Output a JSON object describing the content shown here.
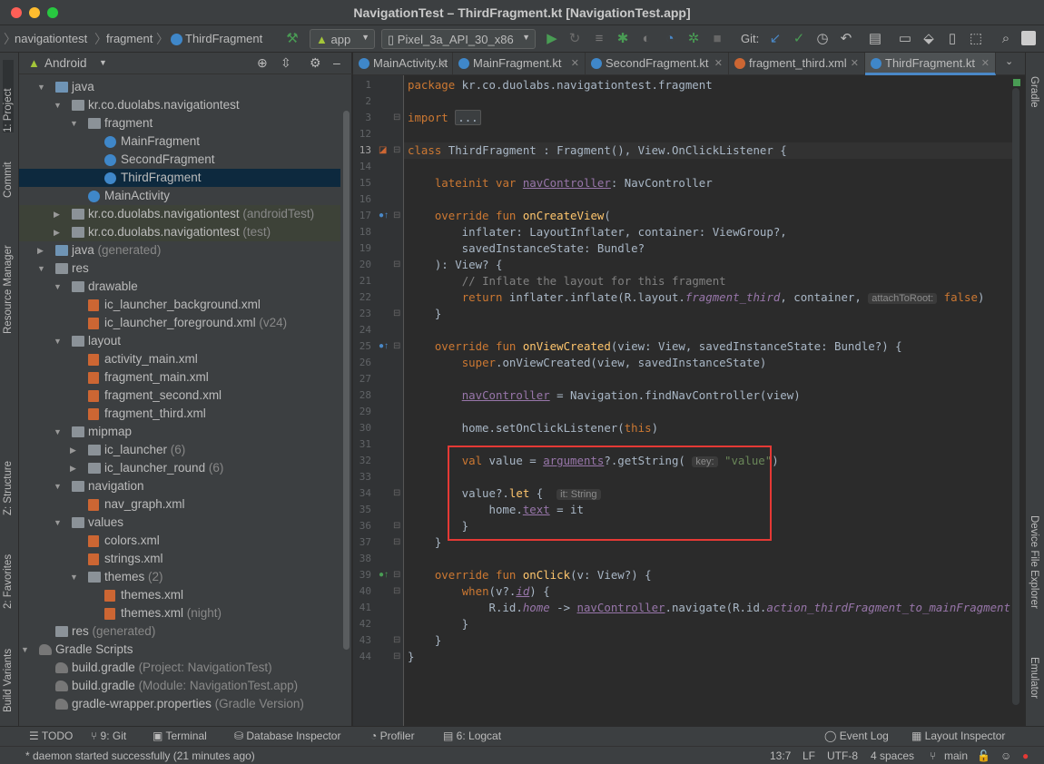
{
  "window": {
    "title": "NavigationTest – ThirdFragment.kt [NavigationTest.app]"
  },
  "breadcrumbs": [
    "navigationtest",
    "fragment",
    "ThirdFragment"
  ],
  "toolbar": {
    "run_config": "app",
    "device": "Pixel_3a_API_30_x86",
    "git_label": "Git:"
  },
  "left_tools": [
    "1: Project",
    "Commit",
    "Resource Manager",
    "Z: Structure",
    "2: Favorites",
    "Build Variants"
  ],
  "right_tools": [
    "Gradle",
    "Device File Explorer",
    "Emulator"
  ],
  "project_panel": {
    "view_mode": "Android"
  },
  "tree": [
    {
      "label": "java",
      "suffix": "",
      "depth": 0,
      "icon": "folder blue",
      "arrow": "down"
    },
    {
      "label": "kr.co.duolabs.navigationtest",
      "suffix": "",
      "depth": 1,
      "icon": "folder",
      "arrow": "down"
    },
    {
      "label": "fragment",
      "suffix": "",
      "depth": 2,
      "icon": "folder",
      "arrow": "down"
    },
    {
      "label": "MainFragment",
      "suffix": "",
      "depth": 3,
      "icon": "kt",
      "arrow": ""
    },
    {
      "label": "SecondFragment",
      "suffix": "",
      "depth": 3,
      "icon": "kt",
      "arrow": ""
    },
    {
      "label": "ThirdFragment",
      "suffix": "",
      "depth": 3,
      "icon": "kt",
      "arrow": "",
      "selected": true
    },
    {
      "label": "MainActivity",
      "suffix": "",
      "depth": 2,
      "icon": "kt",
      "arrow": ""
    },
    {
      "label": "kr.co.duolabs.navigationtest",
      "suffix": "(androidTest)",
      "depth": 1,
      "icon": "folder",
      "arrow": "right",
      "test": true
    },
    {
      "label": "kr.co.duolabs.navigationtest",
      "suffix": "(test)",
      "depth": 1,
      "icon": "folder",
      "arrow": "right",
      "test": true
    },
    {
      "label": "java",
      "suffix": "(generated)",
      "depth": 0,
      "icon": "folder blue",
      "arrow": "right"
    },
    {
      "label": "res",
      "suffix": "",
      "depth": 0,
      "icon": "folder",
      "arrow": "down"
    },
    {
      "label": "drawable",
      "suffix": "",
      "depth": 1,
      "icon": "folder",
      "arrow": "down"
    },
    {
      "label": "ic_launcher_background.xml",
      "suffix": "",
      "depth": 2,
      "icon": "xml",
      "arrow": ""
    },
    {
      "label": "ic_launcher_foreground.xml",
      "suffix": "(v24)",
      "depth": 2,
      "icon": "xml",
      "arrow": ""
    },
    {
      "label": "layout",
      "suffix": "",
      "depth": 1,
      "icon": "folder",
      "arrow": "down"
    },
    {
      "label": "activity_main.xml",
      "suffix": "",
      "depth": 2,
      "icon": "xml",
      "arrow": ""
    },
    {
      "label": "fragment_main.xml",
      "suffix": "",
      "depth": 2,
      "icon": "xml",
      "arrow": ""
    },
    {
      "label": "fragment_second.xml",
      "suffix": "",
      "depth": 2,
      "icon": "xml",
      "arrow": ""
    },
    {
      "label": "fragment_third.xml",
      "suffix": "",
      "depth": 2,
      "icon": "xml",
      "arrow": ""
    },
    {
      "label": "mipmap",
      "suffix": "",
      "depth": 1,
      "icon": "folder",
      "arrow": "down"
    },
    {
      "label": "ic_launcher",
      "suffix": "(6)",
      "depth": 2,
      "icon": "folder",
      "arrow": "right"
    },
    {
      "label": "ic_launcher_round",
      "suffix": "(6)",
      "depth": 2,
      "icon": "folder",
      "arrow": "right"
    },
    {
      "label": "navigation",
      "suffix": "",
      "depth": 1,
      "icon": "folder",
      "arrow": "down"
    },
    {
      "label": "nav_graph.xml",
      "suffix": "",
      "depth": 2,
      "icon": "xml",
      "arrow": ""
    },
    {
      "label": "values",
      "suffix": "",
      "depth": 1,
      "icon": "folder",
      "arrow": "down"
    },
    {
      "label": "colors.xml",
      "suffix": "",
      "depth": 2,
      "icon": "xml",
      "arrow": ""
    },
    {
      "label": "strings.xml",
      "suffix": "",
      "depth": 2,
      "icon": "xml",
      "arrow": ""
    },
    {
      "label": "themes",
      "suffix": "(2)",
      "depth": 2,
      "icon": "folder",
      "arrow": "down"
    },
    {
      "label": "themes.xml",
      "suffix": "",
      "depth": 3,
      "icon": "xml",
      "arrow": ""
    },
    {
      "label": "themes.xml",
      "suffix": "(night)",
      "depth": 3,
      "icon": "xml",
      "arrow": ""
    },
    {
      "label": "res",
      "suffix": "(generated)",
      "depth": 0,
      "icon": "folder",
      "arrow": ""
    },
    {
      "label": "Gradle Scripts",
      "suffix": "",
      "depth": -1,
      "icon": "gradle",
      "arrow": "down"
    },
    {
      "label": "build.gradle",
      "suffix": "(Project: NavigationTest)",
      "depth": 0,
      "icon": "gradle",
      "arrow": ""
    },
    {
      "label": "build.gradle",
      "suffix": "(Module: NavigationTest.app)",
      "depth": 0,
      "icon": "gradle",
      "arrow": ""
    },
    {
      "label": "gradle-wrapper.properties",
      "suffix": "(Gradle Version)",
      "depth": 0,
      "icon": "gradle",
      "arrow": ""
    }
  ],
  "editor_tabs": [
    {
      "label": "MainActivity.kt",
      "active": false,
      "color": "#3f87c9"
    },
    {
      "label": "MainFragment.kt",
      "active": false,
      "color": "#3f87c9"
    },
    {
      "label": "SecondFragment.kt",
      "active": false,
      "color": "#3f87c9"
    },
    {
      "label": "fragment_third.xml",
      "active": false,
      "color": "#cc6633"
    },
    {
      "label": "ThirdFragment.kt",
      "active": true,
      "color": "#3f87c9"
    }
  ],
  "code_lines": [
    {
      "n": "1",
      "html": "<span class='kw'>package</span> kr.co.duolabs.navigationtest.fragment"
    },
    {
      "n": "2",
      "html": ""
    },
    {
      "n": "3",
      "html": "<span class='kw'>import</span> <span class='fold'>...</span>"
    },
    {
      "n": "12",
      "html": ""
    },
    {
      "n": "13",
      "html": "<span class='kw'>class</span> ThirdFragment : Fragment(), View.OnClickListener {",
      "current": true
    },
    {
      "n": "14",
      "html": ""
    },
    {
      "n": "15",
      "html": "    <span class='kw'>lateinit var</span> <span class='prop'>navController</span>: NavController"
    },
    {
      "n": "16",
      "html": ""
    },
    {
      "n": "17",
      "html": "    <span class='kw'>override fun</span> <span class='fn'>onCreateView</span>("
    },
    {
      "n": "18",
      "html": "        inflater: LayoutInflater, container: ViewGroup?,"
    },
    {
      "n": "19",
      "html": "        savedInstanceState: Bundle?"
    },
    {
      "n": "20",
      "html": "    ): View? {"
    },
    {
      "n": "21",
      "html": "        <span class='cm'>// Inflate the layout for this fragment</span>"
    },
    {
      "n": "22",
      "html": "        <span class='kw'>return</span> inflater.inflate(R.layout.<span class='ital'>fragment_third</span>, container, <span class='hint'>attachToRoot:</span> <span class='kw'>false</span>)"
    },
    {
      "n": "23",
      "html": "    }"
    },
    {
      "n": "24",
      "html": ""
    },
    {
      "n": "25",
      "html": "    <span class='kw'>override fun</span> <span class='fn'>onViewCreated</span>(view: View, savedInstanceState: Bundle?) {"
    },
    {
      "n": "26",
      "html": "        <span class='kw'>super</span>.onViewCreated(view, savedInstanceState)"
    },
    {
      "n": "27",
      "html": ""
    },
    {
      "n": "28",
      "html": "        <span class='prop'>navController</span> = Navigation.findNavController(view)"
    },
    {
      "n": "29",
      "html": ""
    },
    {
      "n": "30",
      "html": "        home.setOnClickListener(<span class='kw'>this</span>)"
    },
    {
      "n": "31",
      "html": ""
    },
    {
      "n": "32",
      "html": "        <span class='kw'>val</span> value = <span class='prop'>arguments</span>?.getString( <span class='hint'>key:</span> <span class='str'>\"value\"</span>)"
    },
    {
      "n": "33",
      "html": ""
    },
    {
      "n": "34",
      "html": "        value?.<span class='fn'>let</span> {  <span class='hint'>it: String</span>"
    },
    {
      "n": "35",
      "html": "            home.<span class='prop'>text</span> = it"
    },
    {
      "n": "36",
      "html": "        }"
    },
    {
      "n": "37",
      "html": "    }"
    },
    {
      "n": "38",
      "html": ""
    },
    {
      "n": "39",
      "html": "    <span class='kw'>override fun</span> <span class='fn'>onClick</span>(v: View?) {"
    },
    {
      "n": "40",
      "html": "        <span class='kw'>when</span>(v?.<span class='ital und'>id</span>) {"
    },
    {
      "n": "41",
      "html": "            R.id.<span class='ital'>home</span> -> <span class='prop'>navController</span>.navigate(R.id.<span class='ital'>action_thirdFragment_to_mainFragment</span>)"
    },
    {
      "n": "42",
      "html": "        }"
    },
    {
      "n": "43",
      "html": "    }"
    },
    {
      "n": "44",
      "html": "}"
    }
  ],
  "bottom_tools_left": [
    "TODO",
    "9: Git",
    "Terminal",
    "Database Inspector",
    "Profiler",
    "6: Logcat"
  ],
  "bottom_tools_right": [
    "Event Log",
    "Layout Inspector"
  ],
  "status": {
    "message": "* daemon started successfully (21 minutes ago)",
    "position": "13:7",
    "line_sep": "LF",
    "encoding": "UTF-8",
    "indent": "4 spaces",
    "branch": "main"
  },
  "colors": {
    "accent": "#4a88c7",
    "highlight": "#e53935",
    "run": "#499c54"
  }
}
